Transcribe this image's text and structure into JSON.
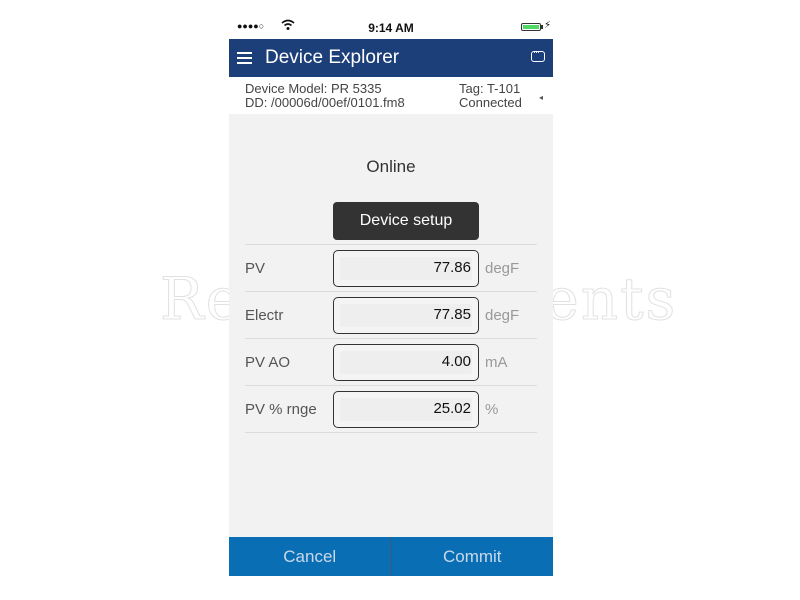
{
  "status_bar": {
    "signal": "●●●●○",
    "time": "9:14 AM",
    "battery_level": "full",
    "charging_icon": "⚡"
  },
  "header": {
    "title": "Device Explorer",
    "menu_icon": "hamburger-icon",
    "right_icon": "chat-bubble-icon"
  },
  "device_info": {
    "model_line": "Device Model:  PR 5335",
    "dd_line": "DD:  /00006d/00ef/0101.fm8",
    "tag_line": "Tag:  T-101",
    "connection_line": "Connected",
    "arrow": "◂"
  },
  "main": {
    "mode_label": "Online",
    "device_setup_label": "Device setup",
    "rows": [
      {
        "label": "PV",
        "value": "77.86",
        "unit": "degF"
      },
      {
        "label": "Electr",
        "value": "77.85",
        "unit": "degF"
      },
      {
        "label": "PV AO",
        "value": "4.00",
        "unit": "mA"
      },
      {
        "label": "PV % rnge",
        "value": "25.02",
        "unit": "%"
      }
    ]
  },
  "watermark": "Rex Instruments",
  "footer": {
    "cancel_label": "Cancel",
    "commit_label": "Commit"
  },
  "colors": {
    "header_bg": "#1c3f7a",
    "footer_bg": "#0a6eb5",
    "setup_button_bg": "#333333",
    "battery": "#4cd964"
  }
}
